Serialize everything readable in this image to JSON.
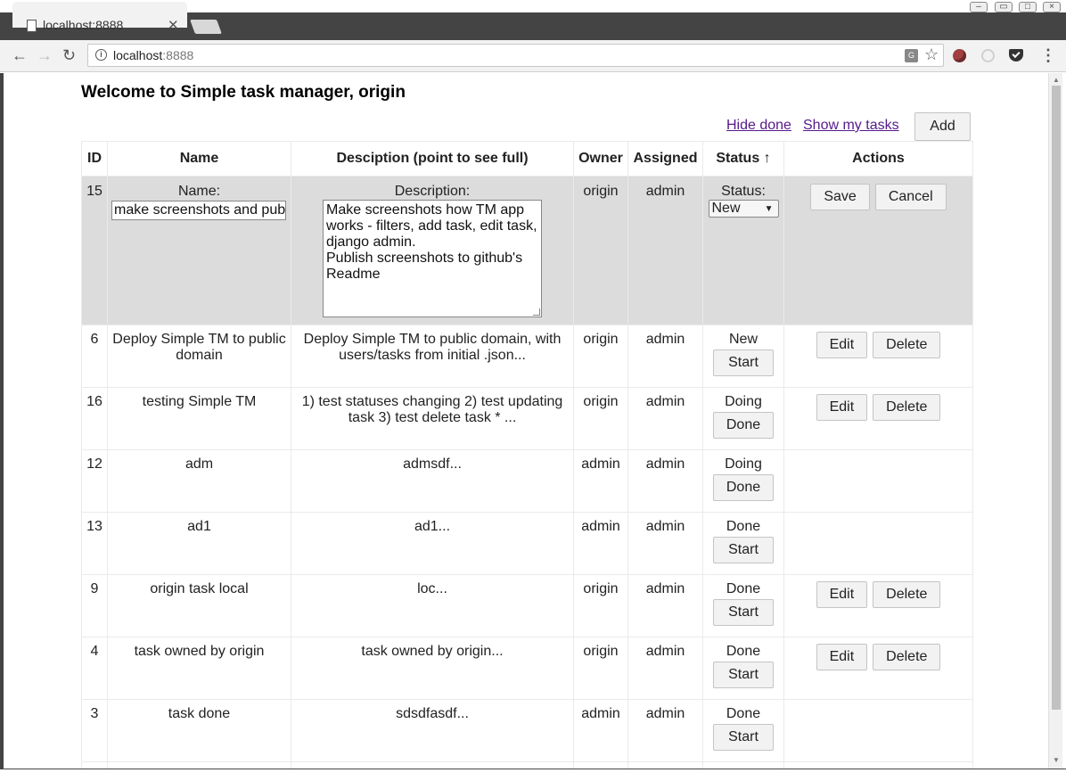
{
  "browser": {
    "tab_title": "localhost:8888",
    "url_host": "localhost",
    "url_port": ":8888"
  },
  "page": {
    "title": "Welcome to Simple task manager, origin",
    "links": {
      "hide_done": "Hide done",
      "show_my_tasks": "Show my tasks"
    },
    "add_button": "Add"
  },
  "table": {
    "headers": {
      "id": "ID",
      "name": "Name",
      "description": "Desciption (point to see full)",
      "owner": "Owner",
      "assigned": "Assigned",
      "status": "Status ↑",
      "actions": "Actions"
    },
    "edit_row": {
      "id": "15",
      "name_label": "Name:",
      "name_value": "make screenshots and pub",
      "description_label": "Description:",
      "description_lines": [
        "Make screenshots how TM app",
        "works - filters, add task, edit task,",
        "django admin.",
        "Publish screenshots to github's",
        "Readme"
      ],
      "owner": "origin",
      "assigned": "admin",
      "status_label": "Status:",
      "status_value": "New",
      "save_label": "Save",
      "cancel_label": "Cancel"
    },
    "rows": [
      {
        "id": "6",
        "name": "Deploy Simple TM to public domain",
        "description": "Deploy Simple TM to public domain, with users/tasks from initial .json...",
        "owner": "origin",
        "assigned": "admin",
        "status": "New",
        "status_action": "Start",
        "edit": "Edit",
        "delete": "Delete"
      },
      {
        "id": "16",
        "name": "testing Simple TM",
        "description": "1) test statuses changing 2) test updating task 3) test delete task * ...",
        "owner": "origin",
        "assigned": "admin",
        "status": "Doing",
        "status_action": "Done",
        "edit": "Edit",
        "delete": "Delete"
      },
      {
        "id": "12",
        "name": "adm",
        "description": "admsdf...",
        "owner": "admin",
        "assigned": "admin",
        "status": "Doing",
        "status_action": "Done",
        "edit": "",
        "delete": ""
      },
      {
        "id": "13",
        "name": "ad1",
        "description": "ad1...",
        "owner": "admin",
        "assigned": "admin",
        "status": "Done",
        "status_action": "Start",
        "edit": "",
        "delete": ""
      },
      {
        "id": "9",
        "name": "origin task local",
        "description": "loc...",
        "owner": "origin",
        "assigned": "admin",
        "status": "Done",
        "status_action": "Start",
        "edit": "Edit",
        "delete": "Delete"
      },
      {
        "id": "4",
        "name": "task owned by origin",
        "description": "task owned by origin...",
        "owner": "origin",
        "assigned": "admin",
        "status": "Done",
        "status_action": "Start",
        "edit": "Edit",
        "delete": "Delete"
      },
      {
        "id": "3",
        "name": "task done",
        "description": "sdsdfasdf...",
        "owner": "admin",
        "assigned": "admin",
        "status": "Done",
        "status_action": "Start",
        "edit": "",
        "delete": ""
      }
    ]
  }
}
